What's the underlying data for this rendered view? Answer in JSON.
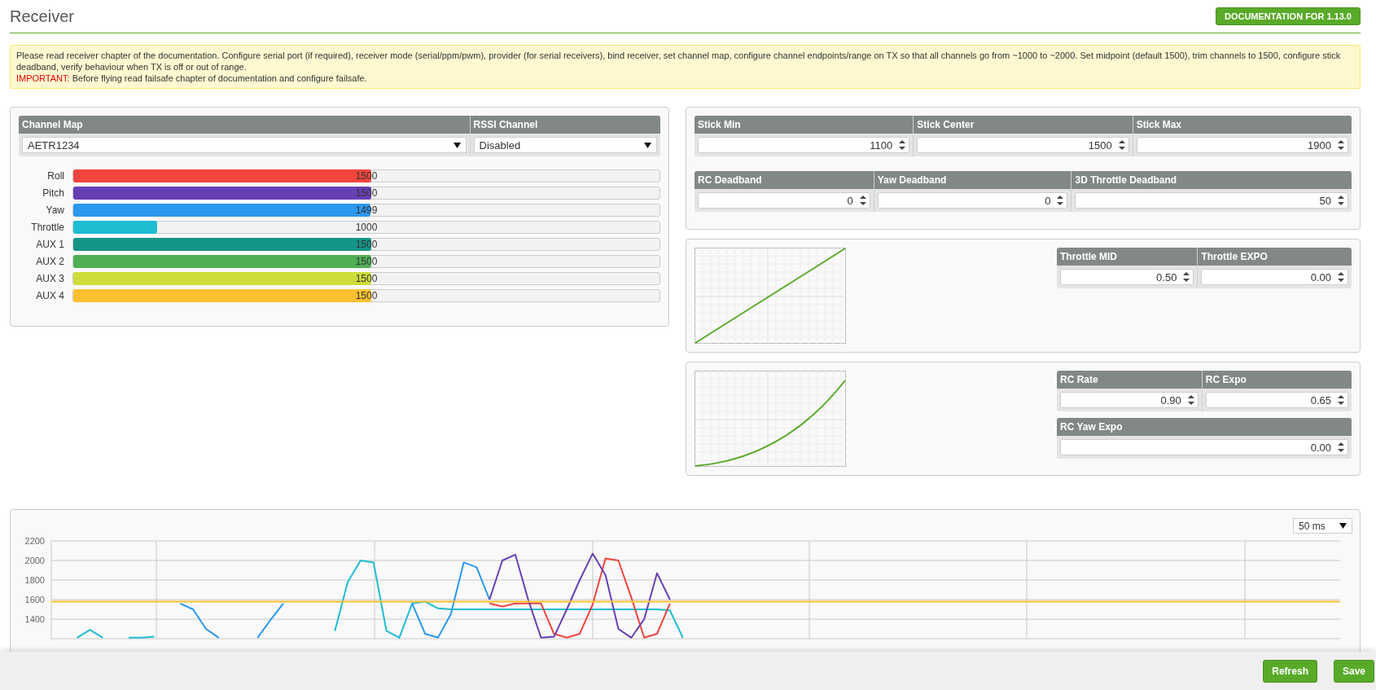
{
  "page_title": "Receiver",
  "doc_button": "DOCUMENTATION FOR 1.13.0",
  "note": {
    "text": "Please read receiver chapter of the documentation. Configure serial port (if required), receiver mode (serial/ppm/pwm), provider (for serial receivers), bind receiver, set channel map, configure channel endpoints/range on TX so that all channels go from ~1000 to ~2000. Set midpoint (default 1500), trim channels to 1500, configure stick deadband, verify behaviour when TX is off or out of range.",
    "important_label": "IMPORTANT:",
    "important_text": "Before flying read failsafe chapter of documentation and configure failsafe."
  },
  "channel_map": {
    "label": "Channel Map",
    "value": "AETR1234"
  },
  "rssi_channel": {
    "label": "RSSI Channel",
    "value": "Disabled"
  },
  "channels": [
    {
      "name": "Roll",
      "color": "#f1453d",
      "level": 0.508,
      "reading": "1500"
    },
    {
      "name": "Pitch",
      "color": "#673fb4",
      "level": 0.508,
      "reading": "1500"
    },
    {
      "name": "Yaw",
      "color": "#2b98f0",
      "level": 0.507,
      "reading": "1499"
    },
    {
      "name": "Throttle",
      "color": "#1fbcd2",
      "level": 0.143,
      "reading": "1000"
    },
    {
      "name": "AUX 1",
      "color": "#159588",
      "level": 0.508,
      "reading": "1500"
    },
    {
      "name": "AUX 2",
      "color": "#50ae55",
      "level": 0.508,
      "reading": "1500"
    },
    {
      "name": "AUX 3",
      "color": "#cddc39",
      "level": 0.508,
      "reading": "1500"
    },
    {
      "name": "AUX 4",
      "color": "#fdc02f",
      "level": 0.508,
      "reading": "1500"
    }
  ],
  "stick_fields": [
    {
      "label": "Stick Min",
      "value": "1100"
    },
    {
      "label": "Stick Center",
      "value": "1500"
    },
    {
      "label": "Stick Max",
      "value": "1900"
    }
  ],
  "deadband_fields": [
    {
      "label": "RC Deadband",
      "value": "0"
    },
    {
      "label": "Yaw Deadband",
      "value": "0"
    },
    {
      "label": "3D Throttle Deadband",
      "value": "50"
    }
  ],
  "throttle_fields": [
    {
      "label": "Throttle MID",
      "value": "0.50"
    },
    {
      "label": "Throttle EXPO",
      "value": "0.00"
    }
  ],
  "rate_fields": [
    {
      "label": "RC Rate",
      "value": "0.90"
    },
    {
      "label": "RC Expo",
      "value": "0.65"
    }
  ],
  "yaw_expo_field": {
    "label": "RC Yaw Expo",
    "value": "0.00"
  },
  "graph": {
    "interval": "50 ms",
    "chart_data": {
      "type": "line",
      "categories": [
        null,
        null,
        null,
        null,
        null,
        null,
        null,
        null,
        null,
        null,
        null,
        null,
        null,
        null,
        null,
        null,
        null,
        null,
        null,
        null,
        null,
        null,
        null,
        null,
        null,
        null,
        null,
        null,
        null,
        null,
        null,
        null,
        null,
        null,
        null,
        null,
        null,
        null,
        null,
        null,
        null,
        null,
        null,
        null,
        null,
        null,
        null,
        null,
        null,
        null,
        null,
        null,
        null,
        null,
        null,
        null,
        null,
        null,
        null,
        null,
        null,
        null,
        null,
        null,
        null,
        null,
        null,
        null,
        null,
        null,
        null,
        null,
        null,
        null,
        null,
        null,
        null,
        null,
        null,
        null,
        null,
        null,
        null,
        null,
        null,
        null,
        null,
        null,
        null,
        null,
        null,
        null,
        null,
        null,
        null,
        null,
        null,
        null,
        null,
        null,
        null
      ],
      "ylim": [
        1200,
        2200
      ],
      "grid": true,
      "yticks": [
        1400,
        1600,
        1800,
        2000,
        2200
      ],
      "series": [
        {
          "color": "#1fbcd2",
          "values": [
            null,
            null,
            1210,
            1290,
            1210,
            null,
            1210,
            1210,
            1220,
            null,
            null,
            null,
            null,
            null,
            null,
            null,
            null,
            null,
            null,
            null,
            null,
            null,
            1280,
            1780,
            2000,
            1980,
            1280,
            1210,
            1560,
            1580,
            1510,
            1500,
            1500,
            1500,
            1500,
            1500,
            1500,
            1500,
            1500,
            1500,
            1500,
            1500,
            1500,
            1500,
            1500,
            1500,
            1500,
            1500,
            1490,
            1210,
            null,
            null,
            null,
            null,
            null,
            null,
            null,
            null,
            null,
            null,
            null,
            null,
            null,
            null,
            null,
            null,
            null,
            null,
            null,
            null,
            null,
            null,
            null,
            null,
            null,
            null,
            null,
            null,
            null,
            null,
            null,
            null,
            null,
            null,
            null,
            null,
            null,
            null,
            null,
            null,
            null,
            null,
            null,
            null,
            null,
            null,
            null,
            null,
            null,
            null,
            null
          ]
        },
        {
          "color": "#2b98f0",
          "values": [
            null,
            null,
            null,
            null,
            null,
            null,
            null,
            null,
            null,
            null,
            1560,
            1500,
            1300,
            1210,
            null,
            null,
            1210,
            1390,
            1560,
            null,
            null,
            null,
            null,
            null,
            null,
            null,
            null,
            null,
            1560,
            1250,
            1210,
            1450,
            1980,
            1930,
            1600,
            null,
            null,
            null,
            null,
            null,
            null,
            null,
            null,
            null,
            null,
            null,
            null,
            null,
            null,
            null,
            null,
            null,
            null,
            null,
            null,
            null,
            null,
            null,
            null,
            null,
            null,
            null,
            null,
            null,
            null,
            null,
            null,
            null,
            null,
            null,
            null,
            null,
            null,
            null,
            null,
            null,
            null,
            null,
            null,
            null,
            null,
            null,
            null,
            null,
            null,
            null,
            null,
            null,
            null,
            null,
            null,
            null,
            null,
            null,
            null,
            null,
            null,
            null,
            null,
            null,
            null
          ]
        },
        {
          "color": "#f1453d",
          "values": [
            null,
            null,
            null,
            null,
            null,
            null,
            null,
            null,
            null,
            null,
            null,
            null,
            null,
            null,
            null,
            null,
            null,
            null,
            null,
            null,
            null,
            null,
            null,
            null,
            null,
            null,
            null,
            null,
            null,
            null,
            null,
            null,
            null,
            null,
            1560,
            1530,
            1560,
            1560,
            1560,
            1250,
            1210,
            1250,
            1550,
            2020,
            2000,
            1620,
            1210,
            1250,
            1560,
            null,
            null,
            null,
            null,
            null,
            null,
            null,
            null,
            null,
            null,
            null,
            null,
            null,
            null,
            null,
            null,
            null,
            null,
            null,
            null,
            null,
            null,
            null,
            null,
            null,
            null,
            null,
            null,
            null,
            null,
            null,
            null,
            null,
            null,
            null,
            null,
            null,
            null,
            null,
            null,
            null,
            null,
            null,
            null,
            null,
            null,
            null,
            null,
            null,
            null,
            null,
            null
          ]
        },
        {
          "color": "#673fb4",
          "values": [
            null,
            null,
            null,
            null,
            null,
            null,
            null,
            null,
            null,
            null,
            null,
            null,
            null,
            null,
            null,
            null,
            null,
            null,
            null,
            null,
            null,
            null,
            null,
            null,
            null,
            null,
            null,
            null,
            null,
            null,
            null,
            null,
            null,
            null,
            1600,
            2000,
            2060,
            1600,
            1210,
            1220,
            1500,
            1800,
            2070,
            1850,
            1300,
            1210,
            1400,
            1870,
            1600,
            null,
            null,
            null,
            null,
            null,
            null,
            null,
            null,
            null,
            null,
            null,
            null,
            null,
            null,
            null,
            null,
            null,
            null,
            null,
            null,
            null,
            null,
            null,
            null,
            null,
            null,
            null,
            null,
            null,
            null,
            null,
            null,
            null,
            null,
            null,
            null,
            null,
            null,
            null,
            null,
            null,
            null,
            null,
            null,
            null,
            null,
            null,
            null,
            null,
            null,
            null,
            null
          ]
        },
        {
          "color": "#fdc02f",
          "values": [
            1580,
            1580,
            1580,
            1580,
            1580,
            1580,
            1580,
            1580,
            1580,
            1580,
            1580,
            1580,
            1580,
            1580,
            1580,
            1580,
            1580,
            1580,
            1580,
            1580,
            1580,
            1580,
            1580,
            1580,
            1580,
            1580,
            1580,
            1580,
            1580,
            1580,
            1580,
            1580,
            1580,
            1580,
            1580,
            1580,
            1580,
            1580,
            1580,
            1580,
            1580,
            1580,
            1580,
            1580,
            1580,
            1580,
            1580,
            1580,
            1580,
            1580,
            1580,
            1580,
            1580,
            1580,
            1580,
            1580,
            1580,
            1580,
            1580,
            1580,
            1580,
            1580,
            1580,
            1580,
            1580,
            1580,
            1580,
            1580,
            1580,
            1580,
            1580,
            1580,
            1580,
            1580,
            1580,
            1580,
            1580,
            1580,
            1580,
            1580,
            1580,
            1580,
            1580,
            1580,
            1580,
            1580,
            1580,
            1580,
            1580,
            1580,
            1580,
            1580,
            1580,
            1580,
            1580,
            1580,
            1580,
            1580,
            1580,
            1580,
            1580
          ]
        }
      ]
    }
  },
  "buttons": [
    "Refresh",
    "Save"
  ]
}
